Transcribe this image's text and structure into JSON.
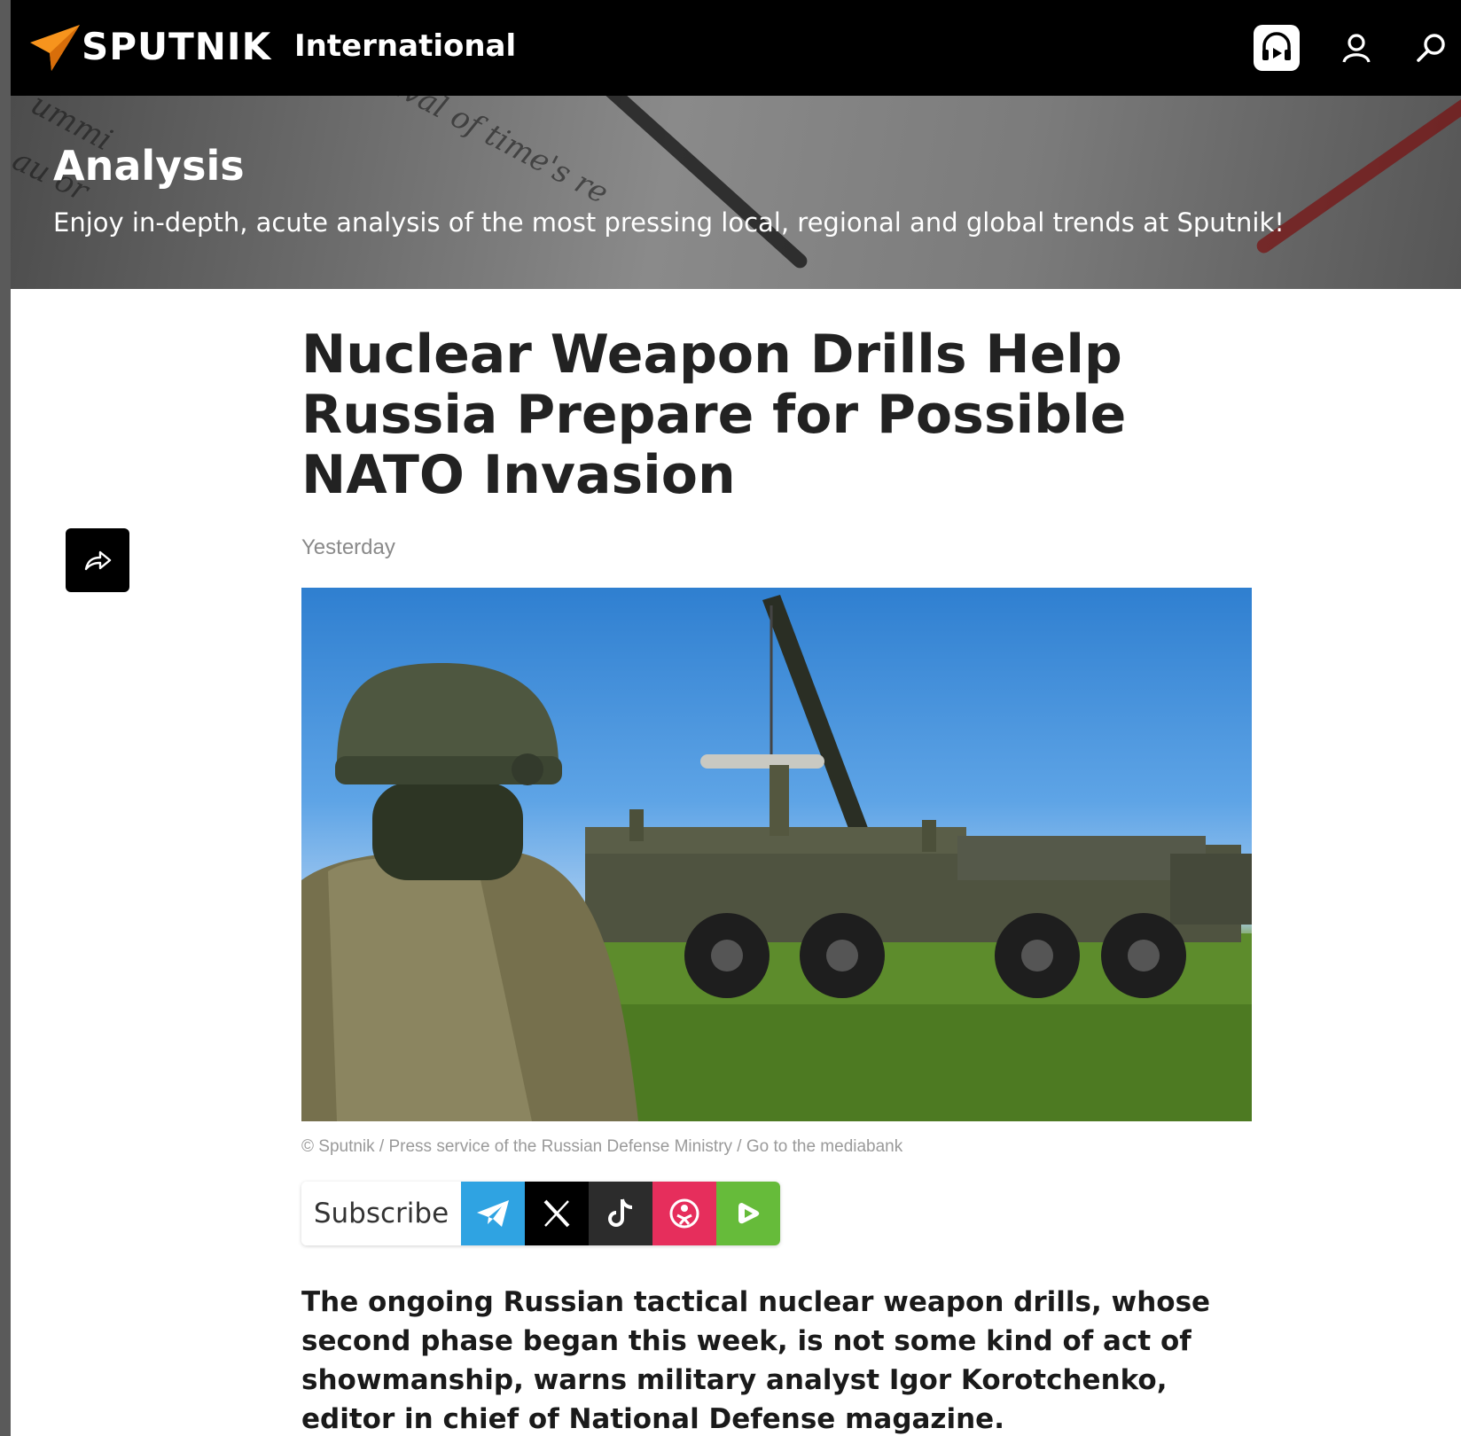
{
  "header": {
    "logo_text": "SPUTNIK",
    "edition": "International",
    "icons": [
      "radio-icon",
      "user-icon",
      "search-icon"
    ],
    "brand_color": "#f7941d"
  },
  "banner": {
    "title": "Analysis",
    "subtitle": "Enjoy in-depth, acute analysis of the most pressing local, regional and global trends at Sputnik!"
  },
  "article": {
    "headline": "Nuclear Weapon Drills Help Russia Prepare for Possible NATO Invasion",
    "date": "Yesterday",
    "photo_credit": "© Sputnik / Press service of the Russian Defense Ministry / Go to the mediabank",
    "lead": "The ongoing Russian tactical nuclear weapon drills, whose second phase began this week, is not some kind of act of showmanship, warns military analyst Igor Korotchenko, editor in chief of National Defense magazine."
  },
  "subscribe": {
    "label": "Subscribe",
    "channels": [
      {
        "name": "telegram",
        "color": "#2fa3e2"
      },
      {
        "name": "x",
        "color": "#000000"
      },
      {
        "name": "tiktok",
        "color": "#2c2c2c"
      },
      {
        "name": "odnoklassniki",
        "color": "#e62e5c"
      },
      {
        "name": "rumble",
        "color": "#66bb3a"
      }
    ]
  }
}
